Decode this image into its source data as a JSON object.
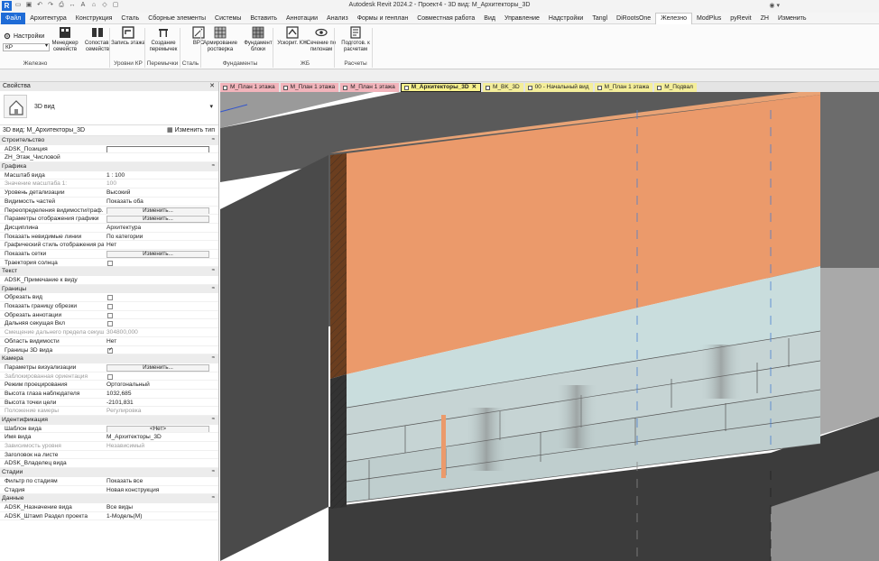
{
  "app": {
    "title": "Autodesk Revit 2024.2 - Проект4 - 3D вид: М_Архитекторы_3D",
    "logo": "R"
  },
  "menu": [
    {
      "label": "Файл",
      "kind": "file"
    },
    {
      "label": "Архитектура"
    },
    {
      "label": "Конструкция"
    },
    {
      "label": "Сталь"
    },
    {
      "label": "Сборные элементы"
    },
    {
      "label": "Системы"
    },
    {
      "label": "Вставить"
    },
    {
      "label": "Аннотации"
    },
    {
      "label": "Анализ"
    },
    {
      "label": "Формы и генплан"
    },
    {
      "label": "Совместная работа"
    },
    {
      "label": "Вид"
    },
    {
      "label": "Управление"
    },
    {
      "label": "Надстройки"
    },
    {
      "label": "Tangl"
    },
    {
      "label": "DiRootsOne"
    },
    {
      "label": "Железно",
      "kind": "active"
    },
    {
      "label": "ModPlus"
    },
    {
      "label": "pyRevit"
    },
    {
      "label": "ZH"
    },
    {
      "label": "Изменить"
    }
  ],
  "ribbon": {
    "settings_label": "Настройки",
    "kr_value": "КР",
    "buttons": [
      {
        "label": "Менеджер семейств",
        "icon": "family-manager-icon"
      },
      {
        "label": "Сопостав. семейств",
        "icon": "family-compare-icon"
      },
      {
        "label": "Запись этажа",
        "icon": "level-record-icon"
      },
      {
        "label": "Создание перемычек",
        "icon": "lintel-create-icon"
      },
      {
        "label": "ВРС",
        "icon": "vrs-icon"
      },
      {
        "label": "Армирование ростверка",
        "icon": "grillage-rebar-icon"
      },
      {
        "label": "Фундамент блоки",
        "icon": "foundation-blocks-icon"
      },
      {
        "label": "Ускорит. КЖ",
        "icon": "accelerate-kzh-icon"
      },
      {
        "label": "Сечение по пилонам",
        "icon": "eye-section-icon"
      },
      {
        "label": "Подготов. к расчетам",
        "icon": "calc-prepare-icon"
      }
    ],
    "groups": [
      "Железно",
      "Уровни КР",
      "Перемычки",
      "Сталь",
      "Фундаменты",
      "ЖБ",
      "Расчеты"
    ]
  },
  "properties": {
    "header": "Свойства",
    "type_name": "3D вид",
    "instance_label": "3D вид: М_Архитекторы_3D",
    "edit_type": "Изменить тип",
    "categories": [
      {
        "name": "Строительство",
        "rows": [
          {
            "k": "ADSK_Позиция",
            "v": "",
            "kind": "input"
          },
          {
            "k": "ZH_Этаж_Числовой",
            "v": ""
          }
        ]
      },
      {
        "name": "Графика",
        "rows": [
          {
            "k": "Масштаб вида",
            "v": "1 : 100"
          },
          {
            "k": "Значение масштаба    1:",
            "v": "100",
            "dim": true
          },
          {
            "k": "Уровень детализации",
            "v": "Высокий"
          },
          {
            "k": "Видимость частей",
            "v": "Показать оба"
          },
          {
            "k": "Переопределения видимости/граф...",
            "v": "Изменить...",
            "kind": "button"
          },
          {
            "k": "Параметры отображения графики",
            "v": "Изменить...",
            "kind": "button"
          },
          {
            "k": "Дисциплина",
            "v": "Архитектура"
          },
          {
            "k": "Показать невидимые линии",
            "v": "По категории"
          },
          {
            "k": "Графический стиль отображения ра...",
            "v": "Нет"
          },
          {
            "k": "Показать сетки",
            "v": "Изменить...",
            "kind": "button"
          },
          {
            "k": "Траектория солнца",
            "v": "",
            "kind": "check"
          }
        ]
      },
      {
        "name": "Текст",
        "rows": [
          {
            "k": "ADSK_Примечание к виду",
            "v": ""
          }
        ]
      },
      {
        "name": "Границы",
        "rows": [
          {
            "k": "Обрезать вид",
            "v": "",
            "kind": "check"
          },
          {
            "k": "Показать границу обрезки",
            "v": "",
            "kind": "check"
          },
          {
            "k": "Обрезать аннотации",
            "v": "",
            "kind": "check"
          },
          {
            "k": "Дальняя секущая Вкл",
            "v": "",
            "kind": "check"
          },
          {
            "k": "Смещение дальнего предела секущ...",
            "v": "304800,000",
            "dim": true
          },
          {
            "k": "Область видимости",
            "v": "Нет"
          },
          {
            "k": "Границы 3D вида",
            "v": "",
            "kind": "check-on"
          }
        ]
      },
      {
        "name": "Камера",
        "rows": [
          {
            "k": "Параметры визуализации",
            "v": "Изменить...",
            "kind": "button"
          },
          {
            "k": "Заблокированная ориентация",
            "v": "",
            "kind": "check",
            "dim": true
          },
          {
            "k": "Режим проецирования",
            "v": "Ортогональный"
          },
          {
            "k": "Высота глаза наблюдателя",
            "v": "1032,685"
          },
          {
            "k": "Высота точки цели",
            "v": "-2101,831"
          },
          {
            "k": "Положение камеры",
            "v": "Регулировка",
            "dim": true
          }
        ]
      },
      {
        "name": "Идентификация",
        "rows": [
          {
            "k": "Шаблон вида",
            "v": "<Нет>",
            "kind": "button"
          },
          {
            "k": "Имя вида",
            "v": "М_Архитекторы_3D"
          },
          {
            "k": "Зависимость уровня",
            "v": "Независимый",
            "dim": true
          },
          {
            "k": "Заголовок на листе",
            "v": ""
          },
          {
            "k": "ADSK_Владелец вида",
            "v": ""
          }
        ]
      },
      {
        "name": "Стадии",
        "rows": [
          {
            "k": "Фильтр по стадиям",
            "v": "Показать все"
          },
          {
            "k": "Стадия",
            "v": "Новая конструкция"
          }
        ]
      },
      {
        "name": "Данные",
        "rows": [
          {
            "k": "ADSK_Назначение вида",
            "v": "Все виды"
          },
          {
            "k": "ADSK_Штамп Раздел проекта",
            "v": "1-Модель(М)"
          }
        ]
      }
    ]
  },
  "view_tabs": [
    {
      "label": "М_План 1 этажа",
      "color": "pink"
    },
    {
      "label": "М_План 1 этажа",
      "color": "pink"
    },
    {
      "label": "М_План 1 этажа",
      "color": "pink"
    },
    {
      "label": "М_Архитекторы_3D",
      "color": "active"
    },
    {
      "label": "М_BK_3D",
      "color": "yellow"
    },
    {
      "label": "00 - Начальный вид",
      "color": "yellow"
    },
    {
      "label": "М_План 1 этажа",
      "color": "yellow"
    },
    {
      "label": "М_Подвал",
      "color": "yellow"
    }
  ],
  "colors": {
    "wall_orange": "#eb9a6b",
    "block_blue": "#c9dddd",
    "dark_slab": "#3c3c3c",
    "brown_edge": "#6b3e1f",
    "accent_blue": "#1e6bd6"
  }
}
